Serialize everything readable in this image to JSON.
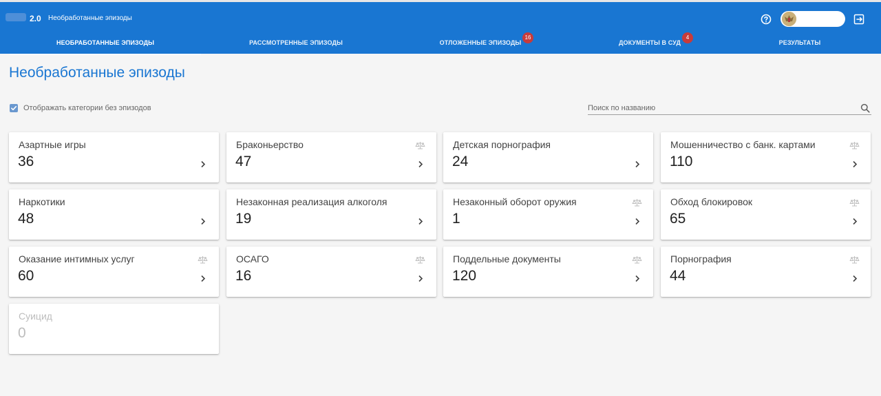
{
  "app": {
    "version": "2.0",
    "title": "Необработанные эпизоды"
  },
  "header_icons": {
    "help": "help-circle-icon",
    "logout": "logout-icon",
    "avatar": "emblem-avatar"
  },
  "tabs": [
    {
      "label": "НЕОБРАБОТАННЫЕ ЭПИЗОДЫ",
      "active": true,
      "badge": ""
    },
    {
      "label": "РАССМОТРЕННЫЕ ЭПИЗОДЫ",
      "active": false,
      "badge": ""
    },
    {
      "label": "ОТЛОЖЕННЫЕ ЭПИЗОДЫ",
      "active": false,
      "badge": "16"
    },
    {
      "label": "ДОКУМЕНТЫ В СУД",
      "active": false,
      "badge": "4"
    },
    {
      "label": "РЕЗУЛЬТАТЫ",
      "active": false,
      "badge": ""
    }
  ],
  "page": {
    "title": "Необработанные эпизоды",
    "show_empty_label": "Отображать категории без эпизодов",
    "show_empty_checked": true,
    "search_placeholder": "Поиск по названию"
  },
  "categories": [
    {
      "name": "Азартные игры",
      "count": "36",
      "scale_icon": false
    },
    {
      "name": "Браконьерство",
      "count": "47",
      "scale_icon": true
    },
    {
      "name": "Детская порнография",
      "count": "24",
      "scale_icon": false
    },
    {
      "name": "Мошенничество с банк. картами",
      "count": "110",
      "scale_icon": true
    },
    {
      "name": "Наркотики",
      "count": "48",
      "scale_icon": false
    },
    {
      "name": "Незаконная реализация алкоголя",
      "count": "19",
      "scale_icon": false
    },
    {
      "name": "Незаконный оборот оружия",
      "count": "1",
      "scale_icon": true
    },
    {
      "name": "Обход блокировок",
      "count": "65",
      "scale_icon": true
    },
    {
      "name": "Оказание интимных услуг",
      "count": "60",
      "scale_icon": true
    },
    {
      "name": "ОСАГО",
      "count": "16",
      "scale_icon": true
    },
    {
      "name": "Поддельные документы",
      "count": "120",
      "scale_icon": true
    },
    {
      "name": "Порнография",
      "count": "44",
      "scale_icon": true
    },
    {
      "name": "Суицид",
      "count": "0",
      "scale_icon": false,
      "disabled": true
    }
  ],
  "colors": {
    "primary": "#1976d2",
    "badge": "#c83b3b",
    "background": "#f5f5f5"
  }
}
